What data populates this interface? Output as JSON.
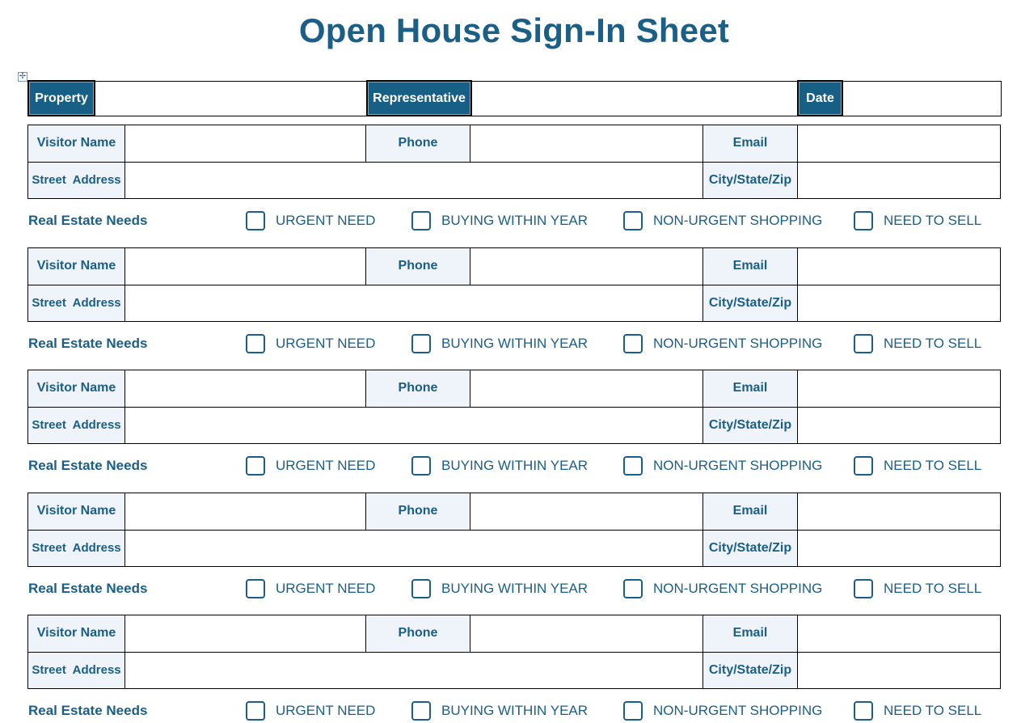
{
  "document": {
    "title": "Open House Sign-In Sheet"
  },
  "header": {
    "property_label": "Property",
    "property_value": "",
    "representative_label": "Representative",
    "representative_value": "",
    "date_label": "Date",
    "date_value": ""
  },
  "visitor_fields": {
    "visitor_name_label": "Visitor Name",
    "phone_label": "Phone",
    "email_label": "Email",
    "street_address_label": "Street  Address",
    "city_state_zip_label": "City/State/Zip"
  },
  "needs": {
    "label": "Real Estate Needs",
    "options": [
      {
        "label": "URGENT NEED",
        "checked": false
      },
      {
        "label": "BUYING WITHIN YEAR",
        "checked": false
      },
      {
        "label": "NON-URGENT SHOPPING",
        "checked": false
      },
      {
        "label": "NEED TO SELL",
        "checked": false
      }
    ]
  },
  "visitors": [
    {
      "visitor_name": "",
      "phone": "",
      "email": "",
      "street_address": "",
      "city_state_zip": ""
    },
    {
      "visitor_name": "",
      "phone": "",
      "email": "",
      "street_address": "",
      "city_state_zip": ""
    },
    {
      "visitor_name": "",
      "phone": "",
      "email": "",
      "street_address": "",
      "city_state_zip": ""
    },
    {
      "visitor_name": "",
      "phone": "",
      "email": "",
      "street_address": "",
      "city_state_zip": ""
    },
    {
      "visitor_name": "",
      "phone": "",
      "email": "",
      "street_address": "",
      "city_state_zip": ""
    }
  ],
  "colors": {
    "accent": "#1b5e86",
    "header_fill": "#185f85",
    "label_fill": "#eef4fa"
  }
}
